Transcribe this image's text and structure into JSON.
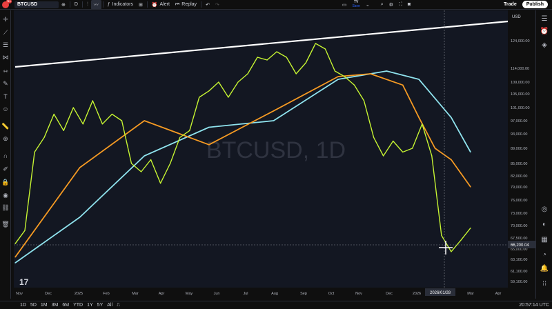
{
  "topbar": {
    "avatar_badge": "51",
    "symbol": "BTCUSD",
    "interval": "D",
    "indicators_label": "Indicators",
    "alert_label": "Alert",
    "replay_label": "Replay",
    "save_brand": "TV",
    "save_label": "Save",
    "trade_label": "Trade",
    "publish_label": "Publish"
  },
  "bottombar": {
    "ranges": [
      "1D",
      "5D",
      "1M",
      "3M",
      "6M",
      "YTD",
      "1Y",
      "5Y",
      "All"
    ],
    "clock": "20:57:14 UTC"
  },
  "chart": {
    "currency": "USD",
    "watermark": "BTCUSD, 1D",
    "logo": "17",
    "date_label": "2026/01/28",
    "price_label": "66,200.04",
    "y_ticks": [
      "124,000.00",
      "114,000.00",
      "109,000.00",
      "105,000.00",
      "101,000.00",
      "97,000.00",
      "93,000.00",
      "89,000.00",
      "85,000.00",
      "82,000.00",
      "79,000.00",
      "76,000.00",
      "73,000.00",
      "70,000.00",
      "67,500.00",
      "65,000.00",
      "63,100.00",
      "61,100.00",
      "59,100.00"
    ],
    "x_ticks": [
      "Nov",
      "Dec",
      "2025",
      "Feb",
      "Mar",
      "Apr",
      "May",
      "Jun",
      "Jul",
      "Aug",
      "Sep",
      "Oct",
      "Nov",
      "Dec",
      "2026",
      "2026/01/28",
      "Mar",
      "Apr"
    ]
  },
  "chart_data": {
    "type": "line",
    "title": "BTCUSD, 1D",
    "ylabel": "USD",
    "series": [
      {
        "name": "",
        "color": "#c6f432",
        "points": [
          [
            0,
            66200
          ],
          [
            3,
            69000
          ],
          [
            6,
            88000
          ],
          [
            9,
            92000
          ],
          [
            12,
            99000
          ],
          [
            15,
            94000
          ],
          [
            18,
            101000
          ],
          [
            21,
            96000
          ],
          [
            24,
            103000
          ],
          [
            27,
            96000
          ],
          [
            30,
            99000
          ],
          [
            33,
            97000
          ],
          [
            36,
            85000
          ],
          [
            39,
            83000
          ],
          [
            42,
            86000
          ],
          [
            45,
            80000
          ],
          [
            48,
            85000
          ],
          [
            51,
            92000
          ],
          [
            54,
            94000
          ],
          [
            57,
            104000
          ],
          [
            60,
            106000
          ],
          [
            63,
            109000
          ],
          [
            66,
            104000
          ],
          [
            69,
            109000
          ],
          [
            72,
            112000
          ],
          [
            75,
            118000
          ],
          [
            78,
            117000
          ],
          [
            81,
            120000
          ],
          [
            84,
            118000
          ],
          [
            87,
            112000
          ],
          [
            90,
            116000
          ],
          [
            93,
            123000
          ],
          [
            96,
            121000
          ],
          [
            99,
            113000
          ],
          [
            102,
            111000
          ],
          [
            105,
            108000
          ],
          [
            108,
            103000
          ],
          [
            111,
            92000
          ],
          [
            114,
            87000
          ],
          [
            117,
            91000
          ],
          [
            120,
            88000
          ],
          [
            123,
            89000
          ],
          [
            126,
            96000
          ],
          [
            129,
            87000
          ],
          [
            132,
            68000
          ],
          [
            135,
            64500
          ],
          [
            138,
            67000
          ],
          [
            141,
            69500
          ]
        ]
      },
      {
        "name": "",
        "color": "#f59a23",
        "points": [
          [
            0,
            63500
          ],
          [
            20,
            84000
          ],
          [
            40,
            97000
          ],
          [
            60,
            90000
          ],
          [
            80,
            100000
          ],
          [
            100,
            111000
          ],
          [
            110,
            112000
          ],
          [
            120,
            108000
          ],
          [
            125,
            98000
          ],
          [
            130,
            89000
          ],
          [
            135,
            86000
          ],
          [
            141,
            79000
          ]
        ]
      },
      {
        "name": "",
        "color": "#8fe3ee",
        "points": [
          [
            0,
            62500
          ],
          [
            20,
            72000
          ],
          [
            40,
            87000
          ],
          [
            60,
            95000
          ],
          [
            80,
            97000
          ],
          [
            100,
            110000
          ],
          [
            115,
            113000
          ],
          [
            125,
            110000
          ],
          [
            135,
            98000
          ],
          [
            141,
            88000
          ]
        ]
      }
    ],
    "trendline_color": "#ffffff",
    "ylim": [
      59100,
      128000
    ],
    "grid": false,
    "legend": "none"
  }
}
